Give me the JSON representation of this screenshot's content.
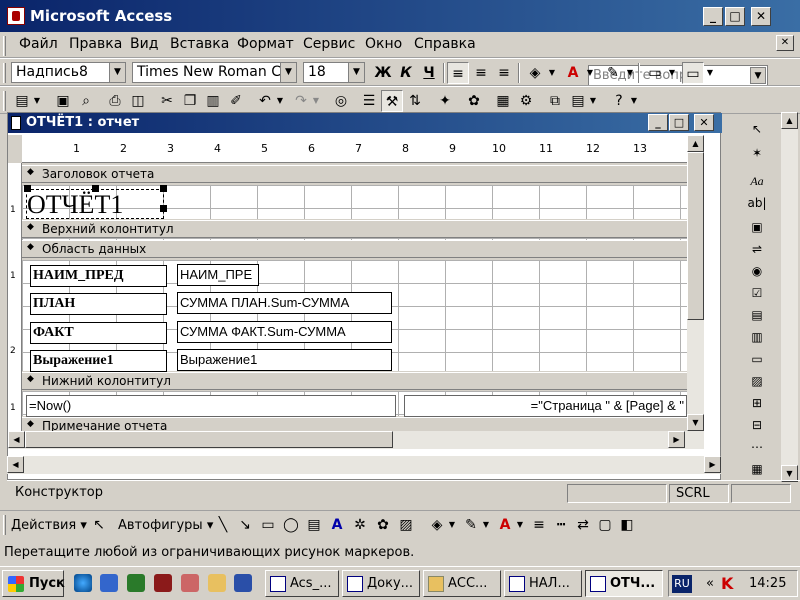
{
  "app": {
    "title": "Microsoft Access"
  },
  "menu": [
    "Файл",
    "Правка",
    "Вид",
    "Вставка",
    "Формат",
    "Сервис",
    "Окно",
    "Справка"
  ],
  "ask": {
    "placeholder": "Введите вопрос"
  },
  "format_toolbar": {
    "object": "Надпись8",
    "font": "Times New Roman Cyr",
    "size": "18",
    "bold": "Ж",
    "italic": "К",
    "underline": "Ч"
  },
  "report": {
    "title": "ОТЧЁТ1 : отчет",
    "ruler": [
      "1",
      "2",
      "3",
      "4",
      "5",
      "6",
      "7",
      "8",
      "9",
      "10",
      "11",
      "12",
      "13"
    ],
    "left_ruler": [
      "1",
      "1",
      "2",
      "1"
    ],
    "sections": {
      "header": "Заголовок отчета",
      "page_header": "Верхний колонтитул",
      "detail": "Область данных",
      "page_footer": "Нижний колонтитул",
      "report_footer": "Примечание отчета"
    },
    "header_label": "ОТЧЁТ1",
    "rows": [
      {
        "label": "НАИМ_ПРЕД",
        "field": "НАИМ_ПРЕ"
      },
      {
        "label": "ПЛАН",
        "field": "СУММА ПЛАН.Sum-СУММА"
      },
      {
        "label": "ФАКТ",
        "field": "СУММА ФАКТ.Sum-СУММА"
      },
      {
        "label": "Выражение1",
        "field": "Выражение1"
      }
    ],
    "footer_now": "=Now()",
    "footer_page": "=\"Страница \" & [Page] & \""
  },
  "status": {
    "mode": "Конструктор",
    "scrl": "SCRL"
  },
  "drawing": {
    "actions": "Действия",
    "autoshapes": "Автофигуры"
  },
  "hint": "Перетащите любой из ограничивающих рисунок маркеров.",
  "taskbar": {
    "start": "Пуск",
    "tasks": [
      "Acs_...",
      "Доку...",
      "АСС...",
      "НАЛ...",
      "ОТЧ..."
    ],
    "lang": "RU",
    "time": "14:25"
  }
}
